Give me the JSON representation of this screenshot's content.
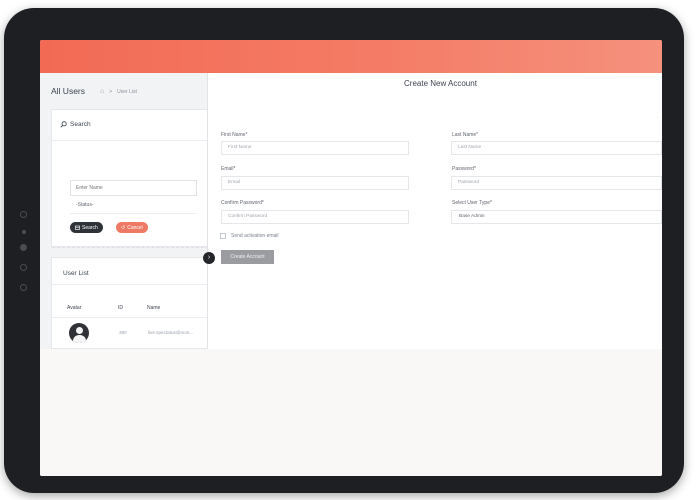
{
  "left_panel": {
    "page_title": "All Users",
    "breadcrumb": "User List",
    "search_card": {
      "title": "Search",
      "name_placeholder": "Enter Name",
      "status_value": "-Status-",
      "search_label": "Search",
      "cancel_label": "Cancel"
    },
    "user_list": {
      "title": "User List",
      "columns": [
        "Avatar",
        "ID",
        "Name"
      ],
      "rows": [
        {
          "id": "380",
          "name": "live.spectatus@mon..."
        }
      ]
    }
  },
  "form": {
    "title": "Create New Account",
    "first_name_label": "First Name*",
    "first_name_placeholder": "First Name",
    "last_name_label": "Last Name*",
    "last_name_placeholder": "Last Name",
    "email_label": "Email*",
    "email_placeholder": "Email",
    "password_label": "Password*",
    "password_placeholder": "Password",
    "confirm_label": "Confirm Password*",
    "confirm_placeholder": "Confirm Password",
    "user_type_label": "Select User Type*",
    "user_type_value": "Base Admin",
    "activation_label": "Send activation email",
    "create_label": "Create Account"
  },
  "colors": {
    "topbar_start": "#f26a54",
    "topbar_end": "#f5917d",
    "search_button": "#2f3237",
    "cancel_button": "#ee7a66",
    "create_button": "#9a9ca0"
  },
  "icons": {
    "search": "search-icon",
    "home": "home-icon",
    "collapse": "chevron-right-icon",
    "cancel": "undo-icon",
    "search_btn": "calendar-icon"
  }
}
